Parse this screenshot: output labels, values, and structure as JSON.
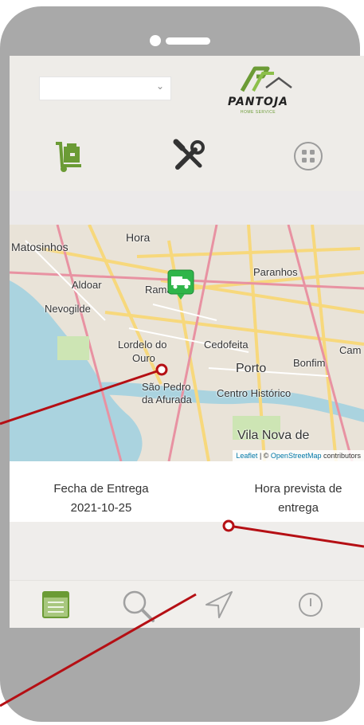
{
  "logo": {
    "wordmark": "PANTOJA",
    "tagline": "HOME SERVICE",
    "brand_color": "#6b9b35"
  },
  "selector": {
    "value": "",
    "icon": "chevron-down-icon"
  },
  "nav": [
    {
      "icon": "hand-truck-boxes-icon"
    },
    {
      "icon": "tools-icon"
    },
    {
      "icon": "apps-icon"
    }
  ],
  "map": {
    "labels": [
      "Matosinhos",
      "Hora",
      "Paranhos",
      "Aldoar",
      "Ramalde",
      "Nevogilde",
      "Lordelo do",
      "Ouro",
      "Cedofeita",
      "Porto",
      "Bonfim",
      "Cam",
      "São Pedro",
      "da Afurada",
      "Centro Histórico",
      "Vila Nova de"
    ],
    "marker_icon": "truck-marker-icon",
    "attribution": {
      "leaflet": "Leaflet",
      "sep": " | © ",
      "osm": "OpenStreetMap",
      "tail": " contributors"
    }
  },
  "delivery": {
    "date_label": "Fecha de Entrega",
    "date_value": "2021-10-25",
    "time_label_line1": "Hora prevista de",
    "time_label_line2": "entrega"
  },
  "tabs": [
    {
      "icon": "list-icon",
      "active": true
    },
    {
      "icon": "search-icon"
    },
    {
      "icon": "navigation-icon"
    },
    {
      "icon": "info-icon"
    }
  ],
  "colors": {
    "accent": "#6b9b35",
    "callout": "#b50f14"
  }
}
